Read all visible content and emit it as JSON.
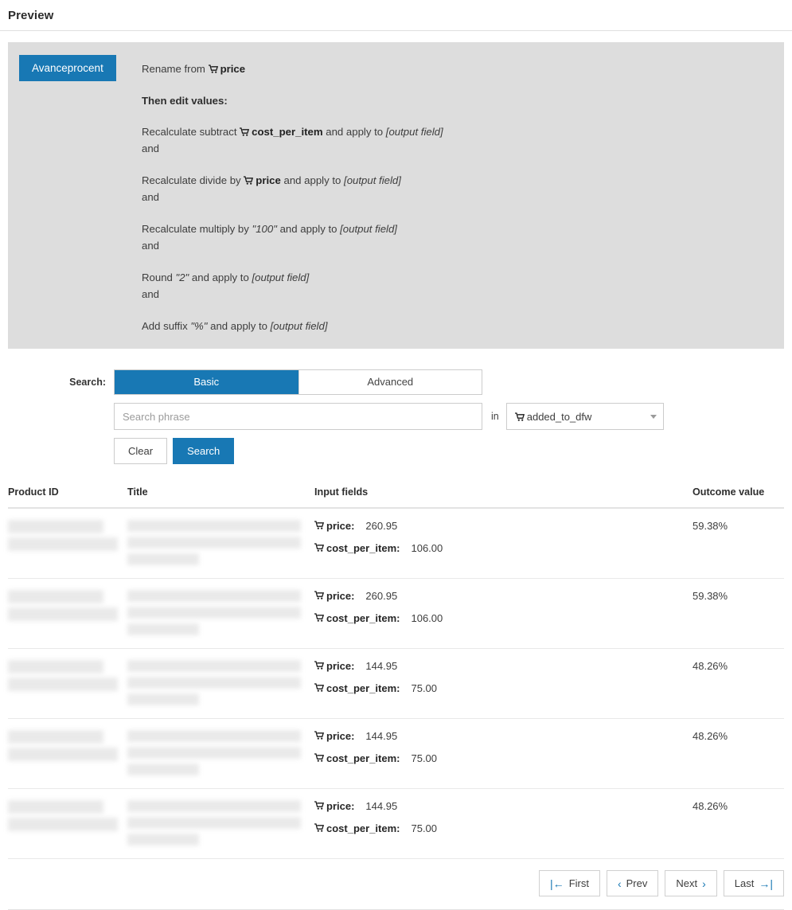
{
  "header": {
    "title": "Preview"
  },
  "rule_panel": {
    "badge_label": "Avanceprocent",
    "rename_prefix": "Rename from",
    "rename_field": "price",
    "edit_heading": "Then edit values:",
    "and_word": "and",
    "output_field_text": "[output field]",
    "steps": [
      {
        "prefix": "Recalculate subtract",
        "field": "cost_per_item",
        "field_is_literal": false,
        "suffix": "and apply to"
      },
      {
        "prefix": "Recalculate divide by",
        "field": "price",
        "field_is_literal": false,
        "suffix": "and apply to"
      },
      {
        "prefix": "Recalculate multiply by",
        "field": "\"100\"",
        "field_is_literal": true,
        "suffix": "and apply to"
      },
      {
        "prefix": "Round",
        "field": "\"2\"",
        "field_is_literal": true,
        "suffix": "and apply to"
      },
      {
        "prefix": "Add suffix",
        "field": "\"%\"",
        "field_is_literal": true,
        "suffix": "and apply to"
      }
    ]
  },
  "search": {
    "label": "Search:",
    "tab_basic": "Basic",
    "tab_advanced": "Advanced",
    "active_tab": "Basic",
    "phrase_value": "",
    "phrase_placeholder": "Search phrase",
    "in_label": "in",
    "field_selected": "added_to_dfw",
    "clear_label": "Clear",
    "search_label": "Search"
  },
  "table": {
    "columns": [
      "Product ID",
      "Title",
      "Input fields",
      "Outcome value"
    ],
    "rows": [
      {
        "product_id": "",
        "title": "",
        "fields": [
          {
            "name": "price:",
            "value": "260.95"
          },
          {
            "name": "cost_per_item:",
            "value": "106.00"
          }
        ],
        "outcome": "59.38%"
      },
      {
        "product_id": "",
        "title": "",
        "fields": [
          {
            "name": "price:",
            "value": "260.95"
          },
          {
            "name": "cost_per_item:",
            "value": "106.00"
          }
        ],
        "outcome": "59.38%"
      },
      {
        "product_id": "",
        "title": "",
        "fields": [
          {
            "name": "price:",
            "value": "144.95"
          },
          {
            "name": "cost_per_item:",
            "value": "75.00"
          }
        ],
        "outcome": "48.26%"
      },
      {
        "product_id": "",
        "title": "",
        "fields": [
          {
            "name": "price:",
            "value": "144.95"
          },
          {
            "name": "cost_per_item:",
            "value": "75.00"
          }
        ],
        "outcome": "48.26%"
      },
      {
        "product_id": "",
        "title": "",
        "fields": [
          {
            "name": "price:",
            "value": "144.95"
          },
          {
            "name": "cost_per_item:",
            "value": "75.00"
          }
        ],
        "outcome": "48.26%"
      }
    ]
  },
  "pagination": {
    "first": "First",
    "prev": "Prev",
    "next": "Next",
    "last": "Last",
    "first_icon": "|←",
    "prev_icon": "‹",
    "next_icon": "›",
    "last_icon": "→|"
  },
  "colors": {
    "accent_blue": "#1878b4",
    "panel_gray": "#dddddd",
    "border_gray": "#cccccc"
  }
}
